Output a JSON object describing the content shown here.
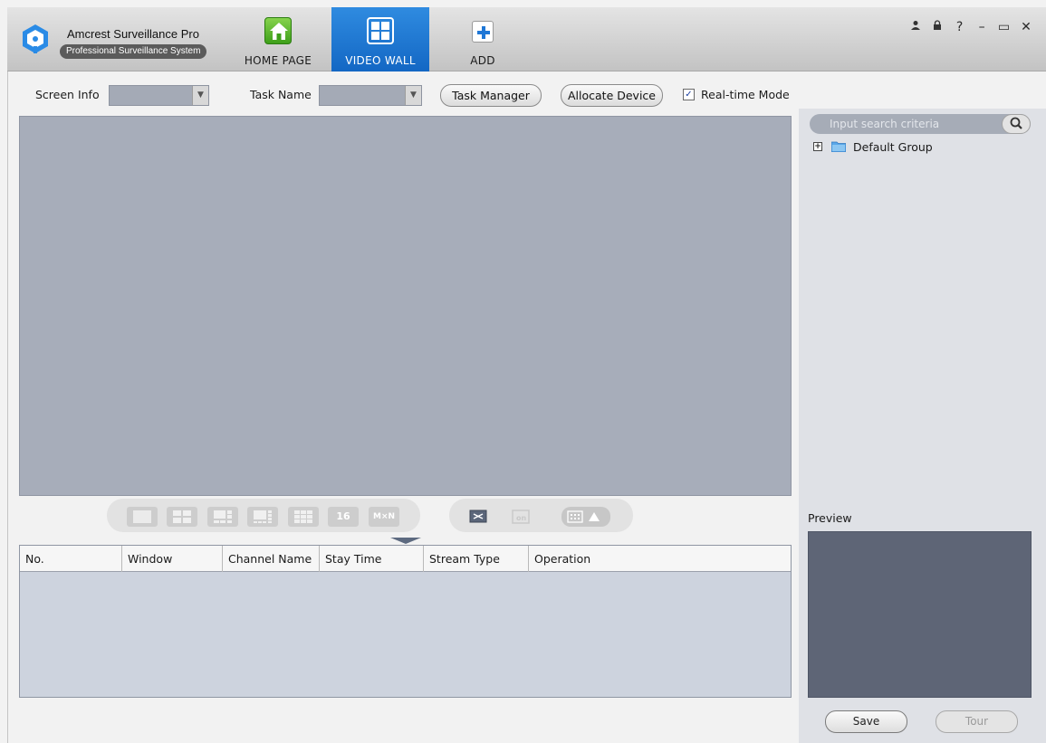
{
  "app": {
    "title": "Amcrest Surveillance Pro",
    "subtitle": "Professional Surveillance System"
  },
  "nav": {
    "tabs": [
      {
        "label": "HOME PAGE",
        "icon": "home-icon"
      },
      {
        "label": "VIDEO WALL",
        "icon": "video-wall-icon",
        "active": true
      },
      {
        "label": "ADD",
        "icon": "plus-icon"
      }
    ]
  },
  "window_controls": {
    "user": "user-icon",
    "lock": "lock-icon",
    "help": "?",
    "minimize": "–",
    "maximize": "▭",
    "close": "✕"
  },
  "toolbar": {
    "screen_info_label": "Screen Info",
    "screen_info_value": "",
    "task_name_label": "Task Name",
    "task_name_value": "",
    "task_manager": "Task Manager",
    "allocate_device": "Allocate Device",
    "realtime_mode": "Real-time Mode",
    "realtime_checked": true
  },
  "layout_buttons": [
    {
      "name": "layout-1-button",
      "icon": "single-window-icon",
      "text": ""
    },
    {
      "name": "layout-4-button",
      "icon": "four-window-icon",
      "text": ""
    },
    {
      "name": "layout-6-button",
      "icon": "six-window-icon",
      "text": ""
    },
    {
      "name": "layout-8-button",
      "icon": "eight-window-icon",
      "text": ""
    },
    {
      "name": "layout-9-button",
      "icon": "nine-window-icon",
      "text": ""
    },
    {
      "name": "layout-16-button",
      "icon": "sixteen-window-icon",
      "text": "16"
    },
    {
      "name": "layout-mxn-button",
      "icon": "custom-layout-icon",
      "text": "M×N"
    }
  ],
  "table": {
    "columns": [
      "No.",
      "Window",
      "Channel Name",
      "Stay Time",
      "Stream Type",
      "Operation"
    ],
    "rows": []
  },
  "right_panel": {
    "search_placeholder": "Input search criteria",
    "tree": [
      {
        "label": "Default Group",
        "icon": "folder-icon"
      }
    ],
    "preview_label": "Preview",
    "save": "Save",
    "tour": "Tour"
  },
  "colors": {
    "active_tab": "#1a73d0",
    "video_area": "#a7adba",
    "preview_bg": "#5e6576"
  }
}
